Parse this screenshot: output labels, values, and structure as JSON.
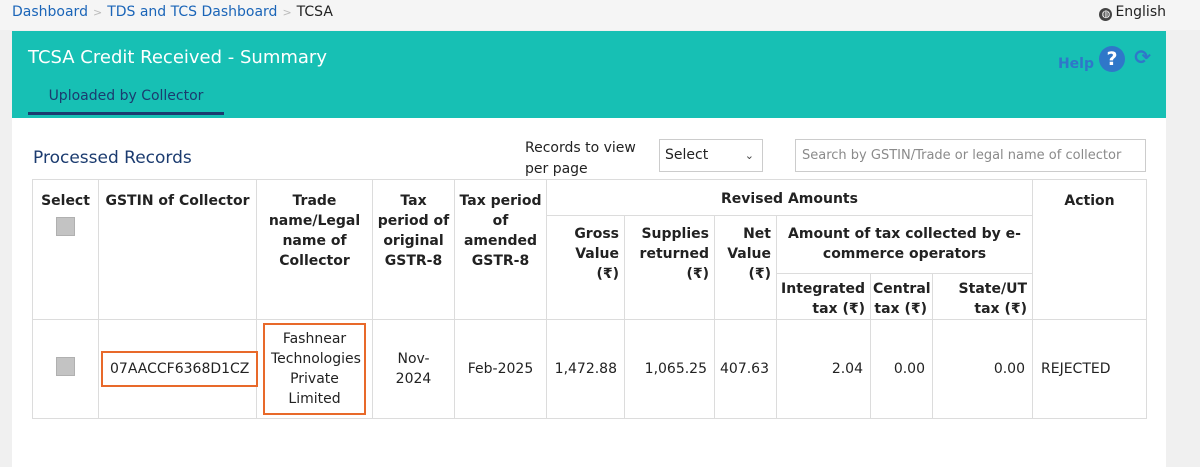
{
  "breadcrumb": {
    "items": [
      "Dashboard",
      "TDS and TCS Dashboard"
    ],
    "current": "TCSA"
  },
  "language": {
    "label": "English",
    "icon": "globe-icon"
  },
  "header": {
    "title": "TCSA Credit Received - Summary",
    "help_label": "Help",
    "help_glyph": "?",
    "refresh_glyph": "⟳"
  },
  "tab": {
    "label": "Uploaded by Collector"
  },
  "section": {
    "title": "Processed Records"
  },
  "records_per_page": {
    "label": "Records to view per page",
    "value": "Select"
  },
  "search": {
    "placeholder": "Search by GSTIN/Trade or legal name of collector"
  },
  "table": {
    "headers": {
      "select": "Select",
      "gstin": "GSTIN of Collector",
      "trade": "Trade name/Legal name of Collector",
      "tax_original": "Tax period of original GSTR-8",
      "tax_amended": "Tax period of amended GSTR-8",
      "revised": "Revised Amounts",
      "action": "Action",
      "gross": "Gross Value (₹)",
      "supplies": "Supplies returned (₹)",
      "net": "Net Value (₹)",
      "amount_tax": "Amount of tax collected by e-commerce operators",
      "integrated": "Integrated tax (₹)",
      "central": "Central tax (₹)",
      "state": "State/UT tax (₹)"
    },
    "rows": [
      {
        "gstin": "07AACCF6368D1CZ",
        "trade": "Fashnear Technologies Private Limited",
        "tax_original": "Nov-2024",
        "tax_amended": "Feb-2025",
        "gross": "1,472.88",
        "supplies": "1,065.25",
        "net": "407.63",
        "integrated": "2.04",
        "central": "0.00",
        "state": "0.00",
        "action": "REJECTED"
      }
    ]
  },
  "colors": {
    "accent": "#17c0b4",
    "link": "#1b65b8",
    "navy": "#1b3b6f",
    "highlight": "#e8692a"
  }
}
